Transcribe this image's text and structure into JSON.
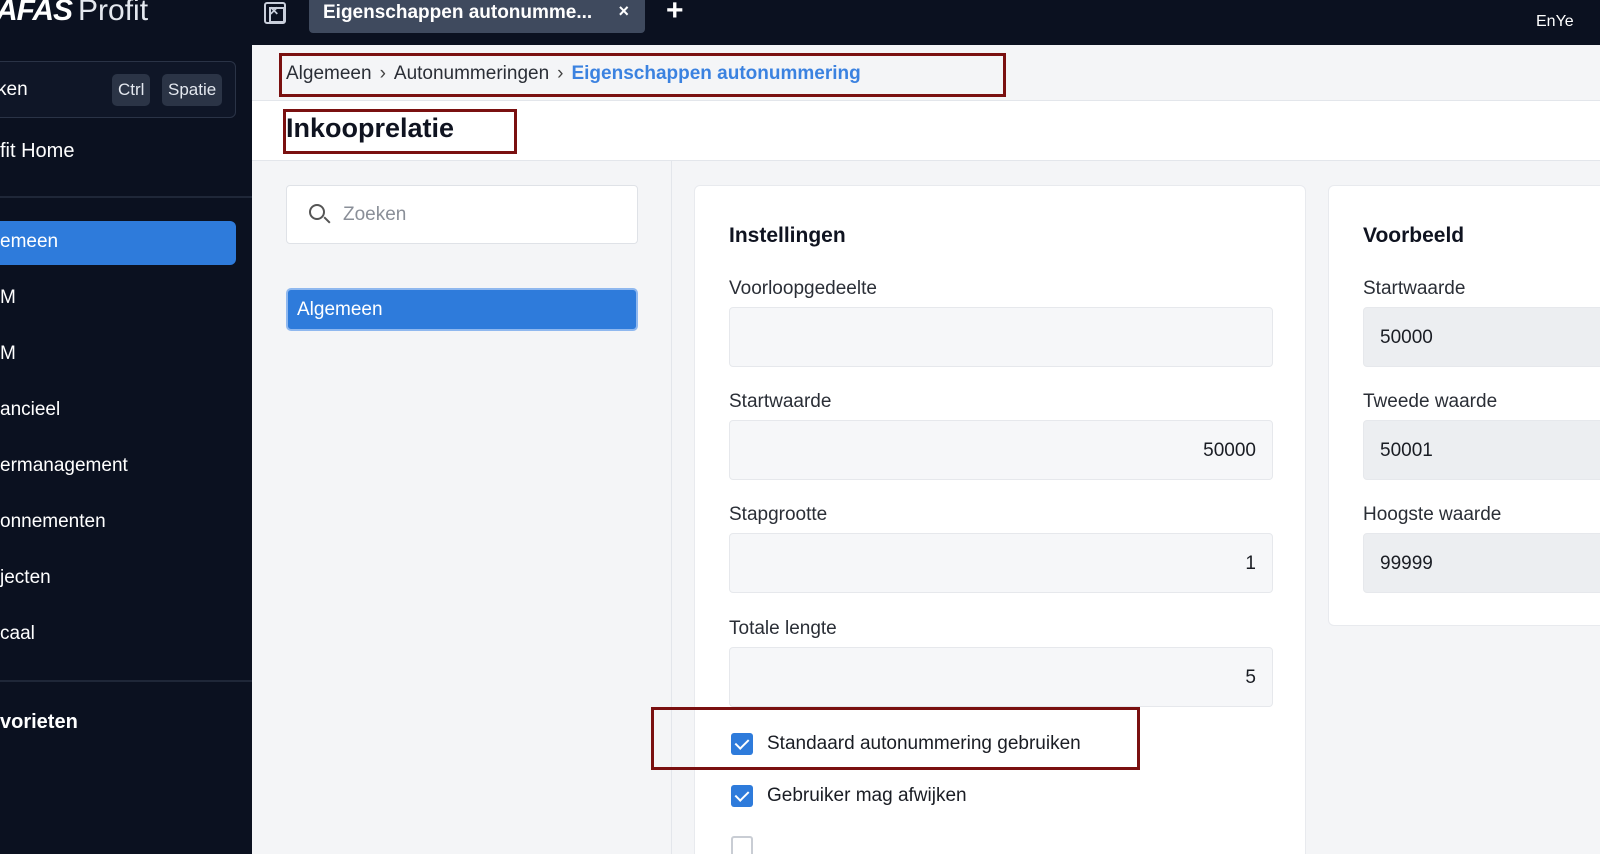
{
  "topbar": {
    "brand": "AFAS",
    "product": "Profit",
    "active_tab": "Eigenschappen autonumme...",
    "tab_close": "×",
    "new_tab": "+",
    "user": "EnYe"
  },
  "sidebar": {
    "search_label": "ken",
    "shortcut_ctrl": "Ctrl",
    "shortcut_space": "Spatie",
    "home": "fit Home",
    "items": [
      {
        "label": "emeen",
        "active": true
      },
      {
        "label": "M"
      },
      {
        "label": "M"
      },
      {
        "label": "ancieel"
      },
      {
        "label": "ermanagement"
      },
      {
        "label": "onnementen"
      },
      {
        "label": "jecten"
      },
      {
        "label": "caal"
      }
    ],
    "favorites": "vorieten"
  },
  "breadcrumb": {
    "items": [
      "Algemeen",
      "Autonummeringen"
    ],
    "separator": "›",
    "current": "Eigenschappen autonummering"
  },
  "page": {
    "title": "Inkooprelatie"
  },
  "left_pane": {
    "search_placeholder": "Zoeken",
    "items": [
      "Algemeen"
    ]
  },
  "instellingen": {
    "title": "Instellingen",
    "fields": [
      {
        "label": "Voorloopgedeelte",
        "value": ""
      },
      {
        "label": "Startwaarde",
        "value": "50000"
      },
      {
        "label": "Stapgrootte",
        "value": "1"
      },
      {
        "label": "Totale lengte",
        "value": "5"
      }
    ],
    "checkboxes": [
      {
        "label": "Standaard autonummering gebruiken",
        "checked": true
      },
      {
        "label": "Gebruiker mag afwijken",
        "checked": true
      }
    ]
  },
  "voorbeeld": {
    "title": "Voorbeeld",
    "fields": [
      {
        "label": "Startwaarde",
        "value": "50000"
      },
      {
        "label": "Tweede waarde",
        "value": "50001"
      },
      {
        "label": "Hoogste waarde",
        "value": "99999"
      }
    ]
  },
  "colors": {
    "topbar_bg": "#0b1120",
    "accent": "#2e7bdb",
    "breadcrumb_current": "#3b82e0",
    "highlight_box": "#7a1010"
  },
  "icons": {
    "tab_icon": "app-switch-icon",
    "search": "search-icon",
    "checkbox": "check-icon"
  }
}
